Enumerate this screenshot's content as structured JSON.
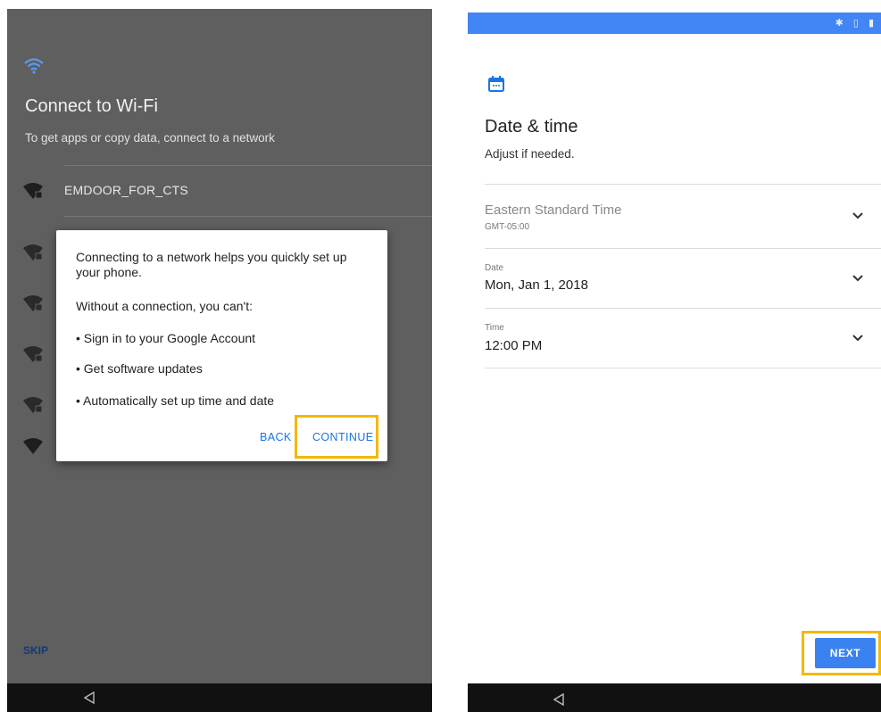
{
  "left": {
    "title": "Connect to Wi-Fi",
    "subtitle": "To get apps or copy data, connect to a network",
    "networks": [
      {
        "name": "EMDOOR_FOR_CTS",
        "icon": "wifi-lock-icon"
      },
      {
        "name": "",
        "icon": "wifi-lock-icon"
      },
      {
        "name": "",
        "icon": "wifi-lock-icon"
      },
      {
        "name": "",
        "icon": "wifi-lock-icon"
      },
      {
        "name": "",
        "icon": "wifi-lock-icon"
      },
      {
        "name": "",
        "icon": "wifi-icon"
      }
    ],
    "skip_label": "SKIP",
    "dialog": {
      "intro": "Connecting to a network helps you quickly set up your phone.",
      "without": "Without a connection, you can't:",
      "bullets": [
        "• Sign in to your Google Account",
        "• Get software updates",
        "• Automatically set up time and date"
      ],
      "back_label": "BACK",
      "continue_label": "CONTINUE"
    }
  },
  "right": {
    "status_icons": "✱ ▯ ▮",
    "title": "Date & time",
    "subtitle": "Adjust if needed.",
    "timezone": {
      "value": "Eastern Standard Time",
      "detail": "GMT-05:00"
    },
    "date": {
      "label": "Date",
      "value": "Mon, Jan 1, 2018"
    },
    "time": {
      "label": "Time",
      "value": "12:00 PM"
    },
    "next_label": "NEXT"
  },
  "colors": {
    "accent": "#1a73e8",
    "highlight": "#f3b800",
    "status_bar": "#4285f4"
  }
}
